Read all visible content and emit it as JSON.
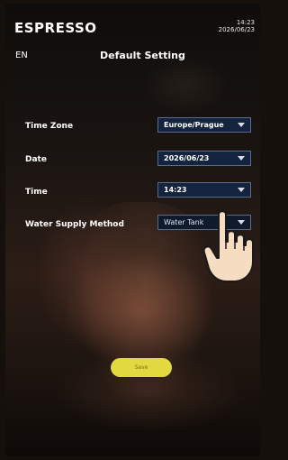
{
  "header": {
    "brand": "ESPRESSO",
    "time": "14:23",
    "date": "2026/06/23",
    "language": "EN",
    "title": "Default Setting"
  },
  "settings": [
    {
      "label": "Time Zone",
      "value": "Europe/Prague"
    },
    {
      "label": "Date",
      "value": "2026/06/23"
    },
    {
      "label": "Time",
      "value": "14:23"
    },
    {
      "label": "Water Supply Method",
      "value": "Water Tank"
    }
  ],
  "actions": {
    "save_label": "Save"
  },
  "colors": {
    "accent_button": "#e2d83f",
    "select_bg": "#14243f",
    "select_border": "#5a6b8a"
  },
  "icons": {
    "dropdown": "chevron-down-icon",
    "pointer": "pointing-hand-icon"
  }
}
